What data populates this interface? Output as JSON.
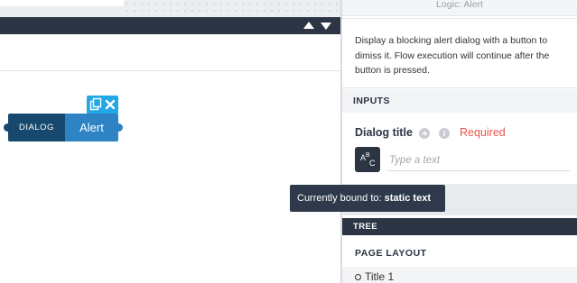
{
  "canvas": {
    "node": {
      "tag": "DIALOG",
      "name": "Alert",
      "color_tag": "#17486d",
      "color_name": "#2d83c4",
      "actions": [
        "copy-icon",
        "close-icon"
      ]
    },
    "header_arrows": [
      "arrow-up-icon",
      "arrow-down-icon"
    ]
  },
  "panel": {
    "title": "Logic: Alert",
    "description": "Display a blocking alert dialog with a button to dimiss it. Flow execution will continue after the button is pressed.",
    "inputs_heading": "INPUTS",
    "field": {
      "label": "Dialog title",
      "required_text": "Required",
      "type_icon_main": "A",
      "type_icon_sup": "B",
      "type_icon_sub": "C",
      "placeholder": "Type a text",
      "value": ""
    },
    "tree_heading": "TREE",
    "tree_subheading": "PAGE LAYOUT",
    "tree_items": [
      {
        "label": "Title 1"
      }
    ]
  },
  "tooltip": {
    "prefix": "Currently bound to:",
    "value": "static text"
  },
  "colors": {
    "dark_bar": "#2b3544",
    "accent_blue": "#23a8e6",
    "required_red": "#e8554e"
  }
}
